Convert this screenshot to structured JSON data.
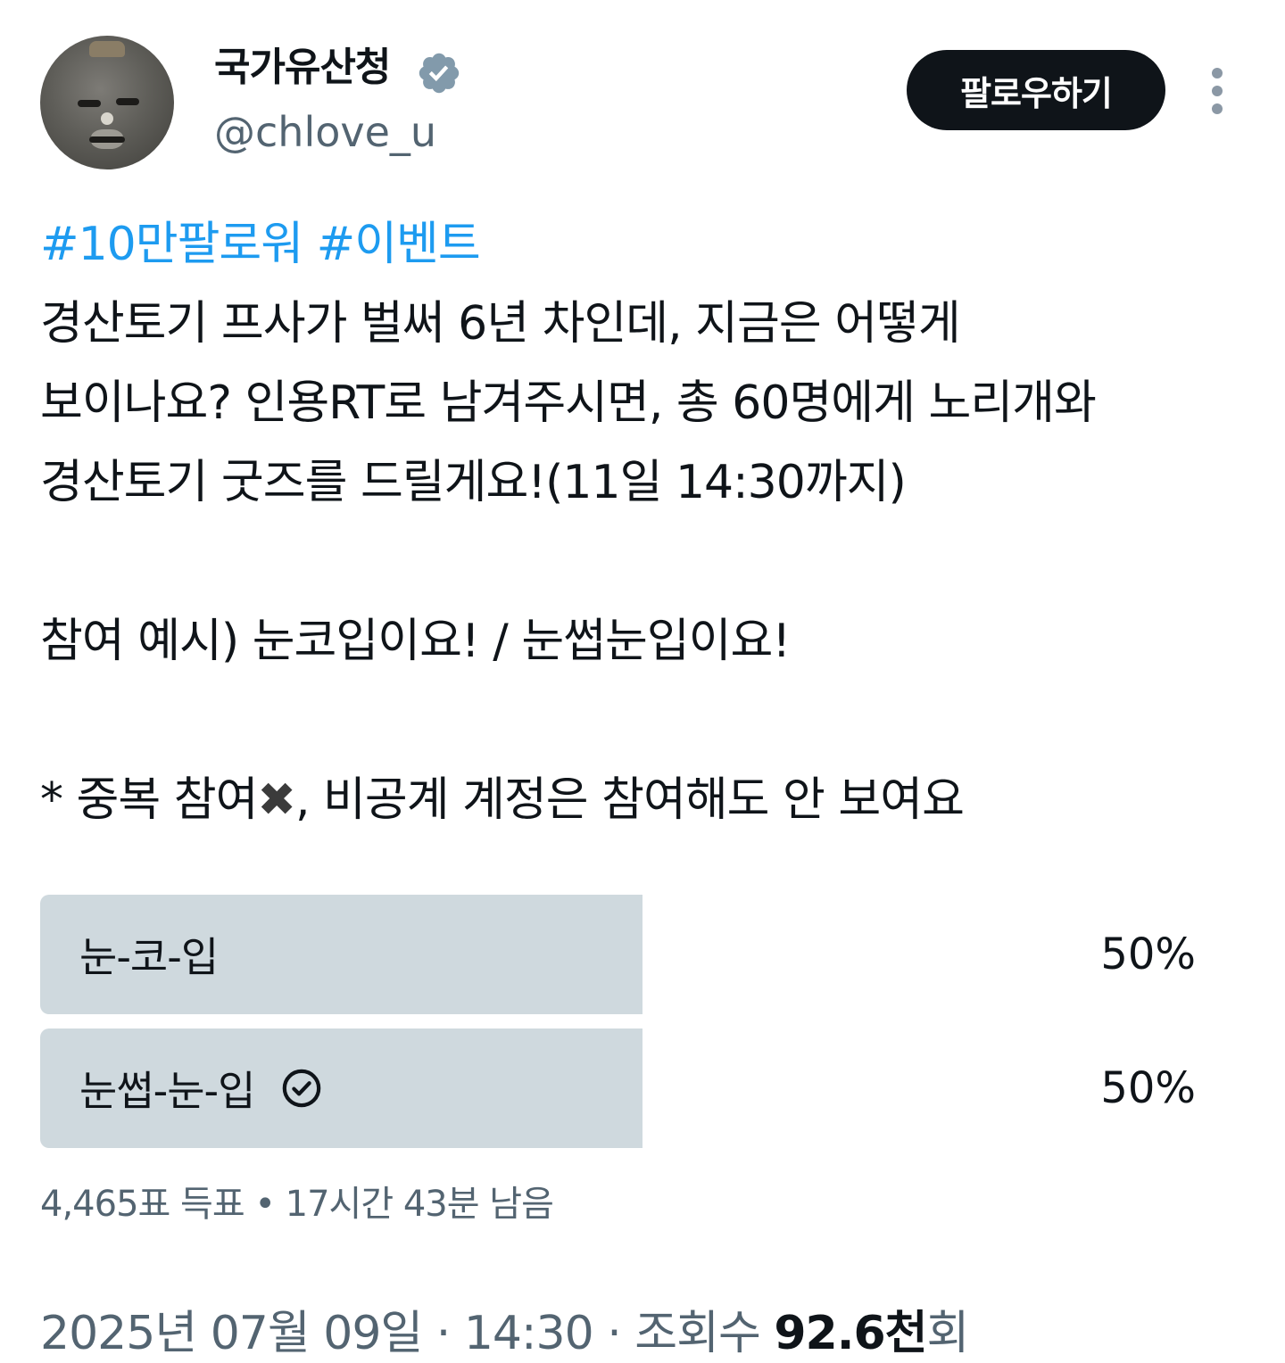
{
  "author": {
    "display_name": "국가유산청",
    "handle": "@chlove_u",
    "avatar_icon": "earthenware-face-avatar",
    "verified_icon": "verified-badge-icon",
    "verified_color": "#829aab"
  },
  "header": {
    "follow_label": "팔로우하기",
    "more_icon": "more-vertical-icon"
  },
  "tweet": {
    "hashtag1": "#10만팔로워",
    "hashtag2": "#이벤트",
    "line1": "경산토기 프사가 벌써 6년 차인데, 지금은 어떻게",
    "line2": "보이나요? 인용RT로 남겨주시면, 총 60명에게 노리개와",
    "line3": "경산토기 굿즈를 드릴게요!(11일 14:30까지)",
    "line4": "참여 예시) 눈코입이요! / 눈썹눈입이요!",
    "line5_prefix": "* 중복 참여",
    "line5_emoji": "✖",
    "line5_suffix": ", 비공계 계정은 참여해도 안 보여요"
  },
  "poll": {
    "options": [
      {
        "label": "눈-코-입",
        "percent_text": "50%",
        "share": 0.5,
        "selected": false
      },
      {
        "label": "눈썹-눈-입",
        "percent_text": "50%",
        "share": 0.5,
        "selected": true
      }
    ],
    "summary": "4,465표 득표 • 17시간 43분 남음",
    "bar_color": "#cfd9de"
  },
  "meta": {
    "date_time": "2025년 07월 09일 · 14:30 · 조회수 ",
    "views": "92.6천",
    "views_suffix": "회"
  },
  "colors": {
    "link": "#1d9bf0",
    "text": "#0f1419",
    "secondary": "#536471"
  }
}
